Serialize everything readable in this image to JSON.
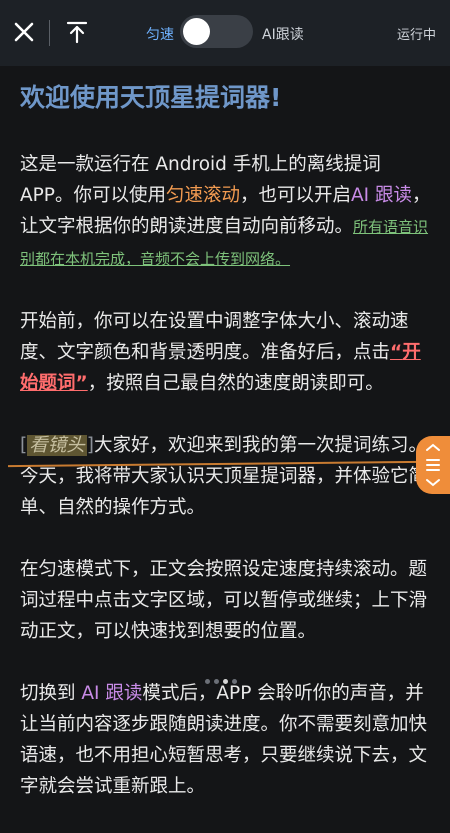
{
  "toolbar": {
    "mode_left": "匀速",
    "mode_right": "AI跟读",
    "status": "运行中"
  },
  "content": {
    "title": "欢迎使用天顶星提词器!",
    "p1": {
      "a": "这是一款运行在 Android 手机上的离线提词 APP。你可以使用",
      "b": "匀速滚动",
      "c": "，也可以开启",
      "d": "AI 跟读",
      "e": "，让文字根据你的朗读进度自动向前移动。",
      "f": "所有语音识别都在本机完成，音频不会上传到网络。"
    },
    "p2": {
      "a": "开始前，你可以在设置中调整字体大小、滚动速度、文字颜色和背景透明度。准备好后，点击",
      "q1": "“",
      "b": "开始题词",
      "q2": "”",
      "c": "，按照自己最自然的速度朗读即可。"
    },
    "p3": {
      "lb": "[",
      "tag": "看镜头",
      "rb": "]",
      "a": "大家好，欢迎来到我的第一次提词练习。今天，我将带大家认识天顶星提词器，并体验它简单、自然的操作方式。"
    },
    "p4": "在匀速模式下，正文会按照设定速度持续滚动。题词过程中点击文字区域，可以暂停或继续；上下滑动正文，可以快速找到想要的位置。",
    "p5": {
      "a": "切换到 ",
      "b": "AI 跟读",
      "c": "模式后，APP 会聆听你的声音，并让当前内容逐步跟随朗读进度。你不需要刻意加快语速，也不用担心短暂思考，只要继续说下去，文字就会尝试重新跟上。"
    }
  }
}
